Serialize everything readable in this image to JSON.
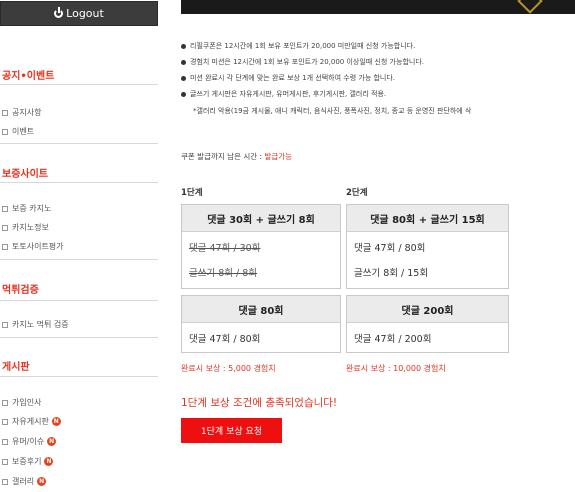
{
  "sidebar": {
    "logout_label": "Logout",
    "sections": [
      {
        "title": "공지•이벤트",
        "items": [
          {
            "label": "공지사항",
            "badge": ""
          },
          {
            "label": "이벤트",
            "badge": ""
          }
        ]
      },
      {
        "title": "보증사이트",
        "items": [
          {
            "label": "보증 카지노",
            "badge": ""
          },
          {
            "label": "카지노정보",
            "badge": ""
          },
          {
            "label": "토토사이트평가",
            "badge": ""
          }
        ]
      },
      {
        "title": "먹튀검증",
        "items": [
          {
            "label": "카지노 먹튀 검증",
            "badge": ""
          }
        ]
      },
      {
        "title": "게시판",
        "items": [
          {
            "label": "가입인사",
            "badge": ""
          },
          {
            "label": "자유게시판",
            "badge": "N"
          },
          {
            "label": "유머/이슈",
            "badge": "N"
          },
          {
            "label": "보증후기",
            "badge": "N"
          },
          {
            "label": "갤러리",
            "badge": "N"
          }
        ]
      }
    ]
  },
  "notes": [
    "리필쿠폰은 12시간에 1회 보유 포인트가 20,000 미만일때 신청 가능합니다.",
    "경험치 미션은 12시간에 1회 보유 포인트가 20,000 이상일때 신청 가능합니다.",
    "미션 완료시 각 단계에 맞는 완료 보상 1개 선택하여 수령 가능 합니다.",
    "글쓰기 게시판은 자유게시판, 유머게시판, 후기게시판, 갤러리 적용.",
    "*갤러리 악용(19금 게시물, 애니 캐릭터, 음식사진, 풍폭사진, 정치, 종교 등 운영진 판단하에 삭"
  ],
  "timer": {
    "label": "쿠폰 발급까지 남은 시간 : ",
    "value": "발급가능"
  },
  "steps": [
    {
      "label": "1단계",
      "missions": [
        {
          "title": "댓글 30회 + 글쓰기 8회",
          "rows": [
            {
              "text": "댓글 47회 / 30회",
              "done": true
            },
            {
              "text": "글쓰기 8회 / 8회",
              "done": true
            }
          ]
        },
        {
          "title": "댓글 80회",
          "rows": [
            {
              "text": "댓글 47회 / 80회",
              "done": false
            }
          ]
        }
      ],
      "reward": "완료시 보상 : 5,000 경험치"
    },
    {
      "label": "2단계",
      "missions": [
        {
          "title": "댓글 80회 + 글쓰기 15회",
          "rows": [
            {
              "text": "댓글 47회 / 80회",
              "done": false
            },
            {
              "text": "글쓰기 8회 / 15회",
              "done": false
            }
          ]
        },
        {
          "title": "댓글 200회",
          "rows": [
            {
              "text": "댓글 47회 / 200회",
              "done": false
            }
          ]
        }
      ],
      "reward": "완료시 보상 : 10,000 경험치"
    }
  ],
  "alert": "1단계 보상 조건에 충족되었습니다!",
  "request_button": "1단계 보상 요청",
  "colors": {
    "accent": "#e5331f",
    "button": "#ee1010",
    "logout_bg": "#3c3c3c"
  }
}
